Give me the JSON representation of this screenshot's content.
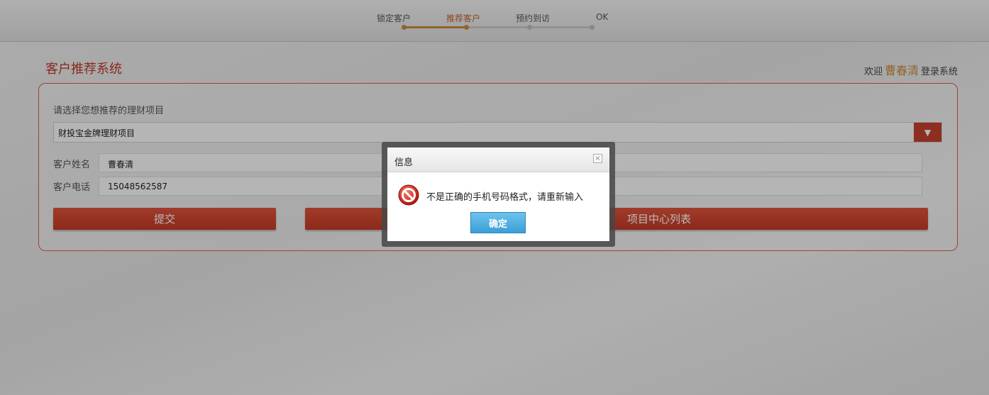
{
  "stepper": {
    "steps": [
      {
        "label": "锁定客户"
      },
      {
        "label": "推荐客户"
      },
      {
        "label": "预约到访"
      },
      {
        "label": "OK"
      }
    ]
  },
  "header": {
    "title": "客户推荐系统",
    "welcome_prefix": "欢迎",
    "user_name": "曹春清",
    "welcome_suffix": "登录系统"
  },
  "form": {
    "select_label": "请选择您想推荐的理财项目",
    "select_value": "财投宝金牌理财项目",
    "name_label": "客户姓名",
    "name_value": "曹春清",
    "phone_label": "客户电话",
    "phone_value": "15048562587",
    "submit_label": "提交",
    "list_label": "项目中心列表"
  },
  "dialog": {
    "title": "信息",
    "close_glyph": "×",
    "message": "不是正确的手机号码格式，请重新输入",
    "ok_label": "确定"
  },
  "colors": {
    "accent": "#c0392b",
    "step_active": "#c98a3c",
    "ok_button": "#3a9fd6"
  },
  "icons": {
    "dialog_icon": "forbidden-icon",
    "select_arrow": "triangle-down-icon"
  }
}
